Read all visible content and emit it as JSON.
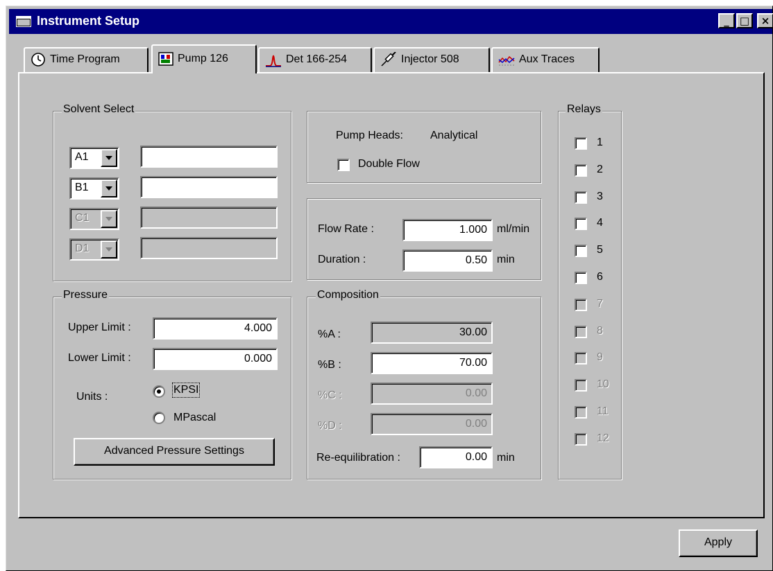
{
  "window": {
    "title": "Instrument Setup",
    "controls": {
      "minimize": "_",
      "maximize": "□",
      "close": "×"
    }
  },
  "tabs": [
    {
      "label": "Time Program",
      "icon": "clock-icon"
    },
    {
      "label": "Pump 126",
      "icon": "pump-icon",
      "active": true
    },
    {
      "label": "Det 166-254",
      "icon": "detector-peak-icon"
    },
    {
      "label": "Injector 508",
      "icon": "syringe-icon"
    },
    {
      "label": "Aux Traces",
      "icon": "aux-traces-icon"
    }
  ],
  "solvent_select": {
    "legend": "Solvent Select",
    "rows": [
      {
        "channel": "A1",
        "name": "",
        "enabled": true
      },
      {
        "channel": "B1",
        "name": "",
        "enabled": true
      },
      {
        "channel": "C1",
        "name": "",
        "enabled": false
      },
      {
        "channel": "D1",
        "name": "",
        "enabled": false
      }
    ]
  },
  "pump_heads": {
    "label": "Pump Heads:",
    "value": "Analytical",
    "double_flow_label": "Double Flow",
    "double_flow_checked": false
  },
  "flow": {
    "flow_rate_label": "Flow Rate :",
    "flow_rate_value": "1.000",
    "flow_rate_unit": "ml/min",
    "duration_label": "Duration :",
    "duration_value": "0.50",
    "duration_unit": "min"
  },
  "pressure": {
    "legend": "Pressure",
    "upper_label": "Upper Limit :",
    "upper_value": "4.000",
    "lower_label": "Lower Limit :",
    "lower_value": "0.000",
    "units_label": "Units :",
    "unit_options": [
      "KPSI",
      "MPascal"
    ],
    "selected_unit": "KPSI",
    "advanced_button": "Advanced Pressure Settings"
  },
  "composition": {
    "legend": "Composition",
    "rows": [
      {
        "label": "%A :",
        "value": "30.00",
        "enabled": false,
        "dimmed_label": false
      },
      {
        "label": "%B :",
        "value": "70.00",
        "enabled": true,
        "dimmed_label": false
      },
      {
        "label": "%C :",
        "value": "0.00",
        "enabled": false,
        "dimmed_label": true
      },
      {
        "label": "%D :",
        "value": "0.00",
        "enabled": false,
        "dimmed_label": true
      }
    ],
    "reequil_label": "Re-equilibration :",
    "reequil_value": "0.00",
    "reequil_unit": "min"
  },
  "relays": {
    "legend": "Relays",
    "items": [
      {
        "label": "1",
        "enabled": true
      },
      {
        "label": "2",
        "enabled": true
      },
      {
        "label": "3",
        "enabled": true
      },
      {
        "label": "4",
        "enabled": true
      },
      {
        "label": "5",
        "enabled": true
      },
      {
        "label": "6",
        "enabled": true
      },
      {
        "label": "7",
        "enabled": false
      },
      {
        "label": "8",
        "enabled": false
      },
      {
        "label": "9",
        "enabled": false
      },
      {
        "label": "10",
        "enabled": false
      },
      {
        "label": "11",
        "enabled": false
      },
      {
        "label": "12",
        "enabled": false
      }
    ]
  },
  "footer": {
    "apply_button": "Apply"
  },
  "colors": {
    "titlebar": "#000080",
    "face": "#c0c0c0",
    "disabled_text": "#808080",
    "detector_icon": "#cc0000"
  }
}
